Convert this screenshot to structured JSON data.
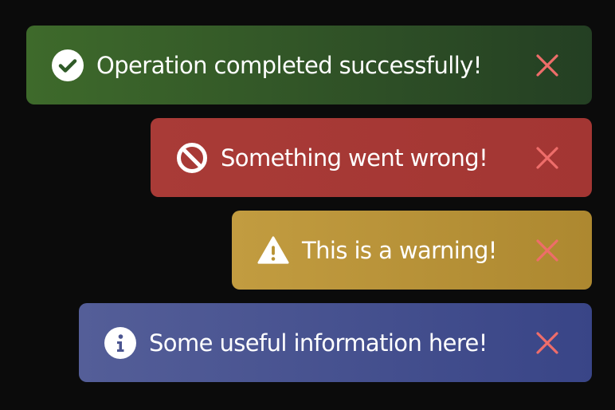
{
  "toasts": [
    {
      "type": "success",
      "icon": "check-circle-icon",
      "message": "Operation completed successfully!",
      "close_icon": "close-icon",
      "color": "#3e6a2b"
    },
    {
      "type": "error",
      "icon": "ban-icon",
      "message": "Something went wrong!",
      "close_icon": "close-icon",
      "color": "#a93b37"
    },
    {
      "type": "warning",
      "icon": "warning-triangle-icon",
      "message": "This is a warning!",
      "close_icon": "close-icon",
      "color": "#c29c40"
    },
    {
      "type": "info",
      "icon": "info-circle-icon",
      "message": "Some useful information here!",
      "close_icon": "close-icon",
      "color": "#545e98"
    }
  ],
  "close_color": "#ee6d6a"
}
